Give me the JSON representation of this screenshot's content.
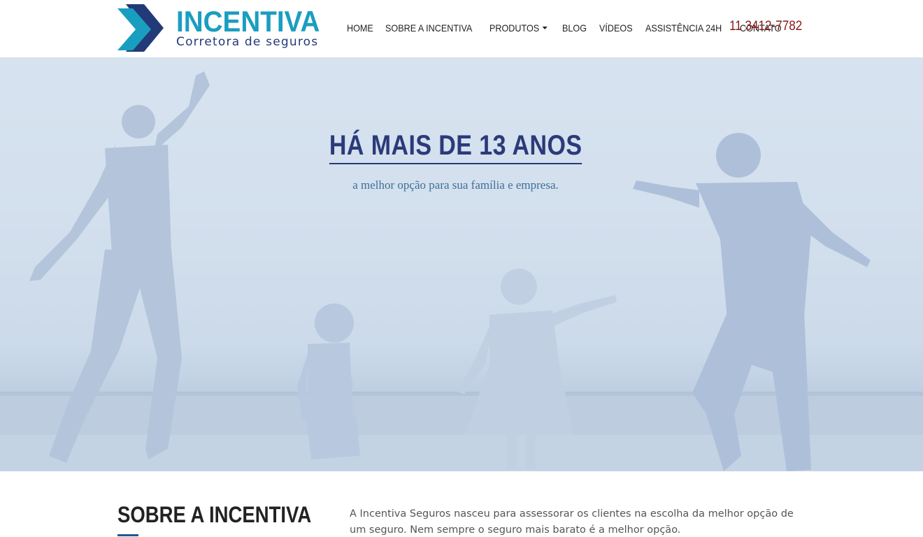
{
  "brand": {
    "name": "INCENTIVA",
    "tagline": "Corretora de seguros",
    "primary_color": "#1a9ec0",
    "secondary_color": "#233a78"
  },
  "nav": {
    "items": [
      {
        "label": "HOME"
      },
      {
        "label": "SOBRE A INCENTIVA"
      },
      {
        "label": "PRODUTOS"
      },
      {
        "label": "BLOG"
      },
      {
        "label": "VÍDEOS"
      },
      {
        "label": "ASSISTÊNCIA 24H"
      },
      {
        "label": "CONTATO"
      }
    ],
    "dropdown_icon": "chevron-down-icon"
  },
  "phone": "11 3412-7782",
  "hero": {
    "title": "HÁ MAIS DE 13 ANOS",
    "subtitle": "a melhor opção para sua família e empresa."
  },
  "about": {
    "title": "SOBRE A INCENTIVA",
    "text": "A Incentiva Seguros nasceu para assessorar os clientes na escolha da melhor opção de um seguro. Nem sempre o seguro mais barato é a melhor opção."
  }
}
